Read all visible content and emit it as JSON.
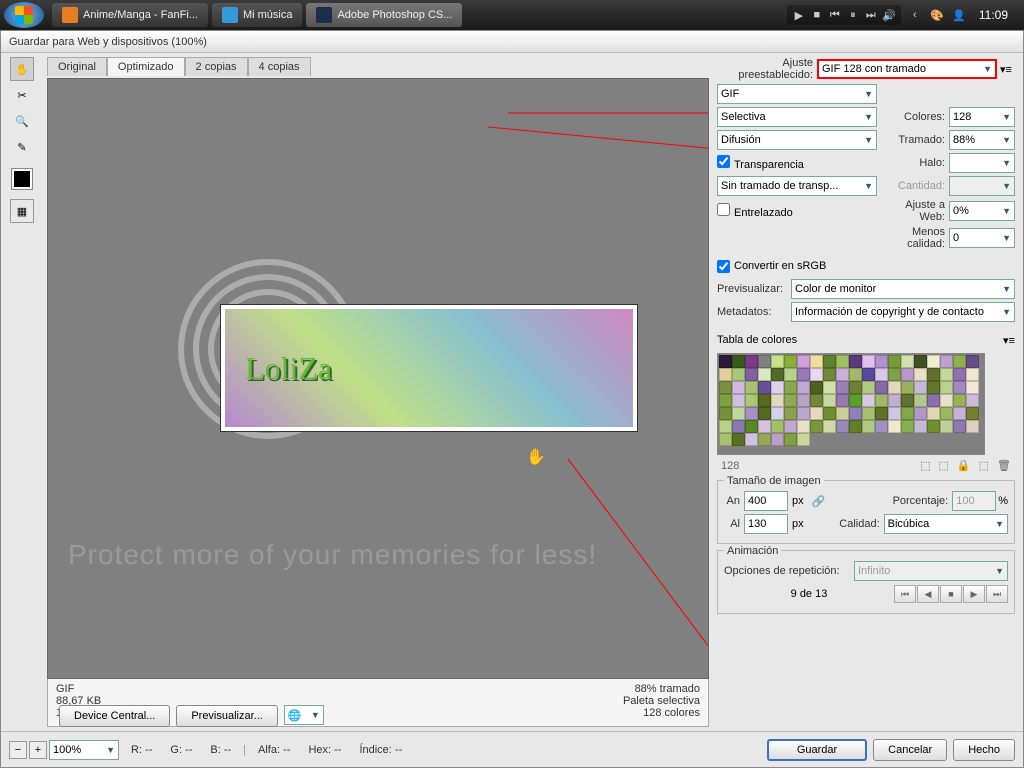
{
  "taskbar": {
    "items": [
      {
        "label": "Anime/Manga - FanFi...",
        "color": "#e67e22"
      },
      {
        "label": "Mi música",
        "color": "#3498db"
      },
      {
        "label": "Adobe Photoshop CS...",
        "color": "#1c2e4a"
      }
    ],
    "clock": "11:09"
  },
  "dialog": {
    "title": "Guardar para Web y dispositivos (100%)"
  },
  "tabs": [
    "Original",
    "Optimizado",
    "2 copias",
    "4 copias"
  ],
  "preview": {
    "art_text": "LoliZa",
    "watermark_small": "Protect more of your memories for less!"
  },
  "info": {
    "format": "GIF",
    "size": "88,67 KB",
    "time": "17 seg. a 56,6 Kbps",
    "dither": "88% tramado",
    "palette": "Paleta selectiva",
    "colors": "128 colores"
  },
  "settings": {
    "preset_lbl": "Ajuste preestablecido:",
    "preset": "GIF 128 con tramado",
    "format": "GIF",
    "reduction": "Selectiva",
    "colors_lbl": "Colores:",
    "colors": "128",
    "dither_method": "Difusión",
    "dither_lbl": "Tramado:",
    "dither": "88%",
    "transparency": "Transparencia",
    "matte_lbl": "Halo:",
    "trans_dither": "Sin tramado de transp...",
    "amount_lbl": "Cantidad:",
    "interlaced": "Entrelazado",
    "websnap_lbl": "Ajuste a Web:",
    "websnap": "0%",
    "lossy_lbl": "Menos calidad:",
    "lossy": "0",
    "srgb": "Convertir en sRGB",
    "preview_lbl": "Previsualizar:",
    "preview": "Color de monitor",
    "meta_lbl": "Metadatos:",
    "meta": "Información de copyright y de contacto",
    "colortable_lbl": "Tabla de colores",
    "colortable_count": "128",
    "imgsize_lbl": "Tamaño de imagen",
    "w_lbl": "An",
    "w": "400",
    "px": "px",
    "h_lbl": "Al",
    "h": "130",
    "pct_lbl": "Porcentaje:",
    "pct": "100",
    "quality_lbl": "Calidad:",
    "quality": "Bicúbica",
    "anim_lbl": "Animación",
    "loop_lbl": "Opciones de repetición:",
    "loop": "Infinito",
    "frame": "9 de 13"
  },
  "bottom": {
    "zoom": "100%",
    "r": "R: --",
    "g": "G: --",
    "b": "B: --",
    "alpha": "Alfa: --",
    "hex": "Hex: --",
    "index": "Índice: --",
    "device": "Device Central...",
    "prev": "Previsualizar...",
    "save": "Guardar",
    "cancel": "Cancelar",
    "done": "Hecho"
  },
  "palette": [
    "#2a1a3a",
    "#3a5a1a",
    "#7a3a8a",
    "#9abада",
    "#c8e088",
    "#88b038",
    "#d0a0e0",
    "#f0e0a0",
    "#608030",
    "#a0c060",
    "#5a3a7a",
    "#e0c0f0",
    "#b090d0",
    "#7a9a3a",
    "#d0e0b0",
    "#405020",
    "#f0f0d0",
    "#c0a0d0",
    "#90b050",
    "#6a4a8a",
    "#e0d0a0",
    "#a8c878",
    "#8060a0",
    "#d8e8c0",
    "#506828",
    "#b8d088",
    "#9878b8",
    "#e8d8f0",
    "#708838",
    "#c8b0d8",
    "#a0b868",
    "#5848a0",
    "#d8c8e8",
    "#80a048",
    "#b898c8",
    "#e8e0c0",
    "#607030",
    "#c0d898",
    "#9070b0",
    "#f0e8d0",
    "#789040",
    "#d0b8e0",
    "#a8c070",
    "#685098",
    "#e0d0f0",
    "#88a850",
    "#c0a8d0",
    "#506020",
    "#d0e0a8",
    "#9880b8",
    "#708030",
    "#b0c880",
    "#8868a8",
    "#e0d8b8",
    "#98b060",
    "#c8b8d8",
    "#607828",
    "#b8d090",
    "#a088c0",
    "#f0e8d8",
    "#80a040",
    "#d0c0e0",
    "#a8c878",
    "#586820",
    "#e0d8c0",
    "#90a858",
    "#b8a0c8",
    "#708838",
    "#c8d8a0",
    "#9878b0",
    "#58a028",
    "#d8c8e0",
    "#a0b868",
    "#c0b0d0",
    "#607030",
    "#b0c888",
    "#8870a8",
    "#e8e0c8",
    "#98b058",
    "#d0b8d8",
    "#789038",
    "#c0d8a0",
    "#a890c0",
    "#506820",
    "#d8d0e8",
    "#88a050",
    "#b8a8d0",
    "#e8d8c0",
    "#709030",
    "#c8d098",
    "#9080b8",
    "#a8c070",
    "#607028",
    "#d0c8e0",
    "#80a848",
    "#b098c8",
    "#e0d8b0",
    "#98b860",
    "#c8b0d8",
    "#708030",
    "#b8d088",
    "#8878b0",
    "#588820",
    "#d8c0e0",
    "#a0c068",
    "#c0a8d0",
    "#e8e0c8",
    "#789838",
    "#d0d8a8",
    "#9888b8",
    "#608028",
    "#b0c880",
    "#a090c0",
    "#f0e8d0",
    "#88b050",
    "#c8b8d8",
    "#709030",
    "#c0d098",
    "#9078b0",
    "#e0d0c0",
    "#a8c070",
    "#587020",
    "#d0c0e0",
    "#98a858",
    "#b8a0c8",
    "#80a040",
    "#c8d8a0"
  ]
}
